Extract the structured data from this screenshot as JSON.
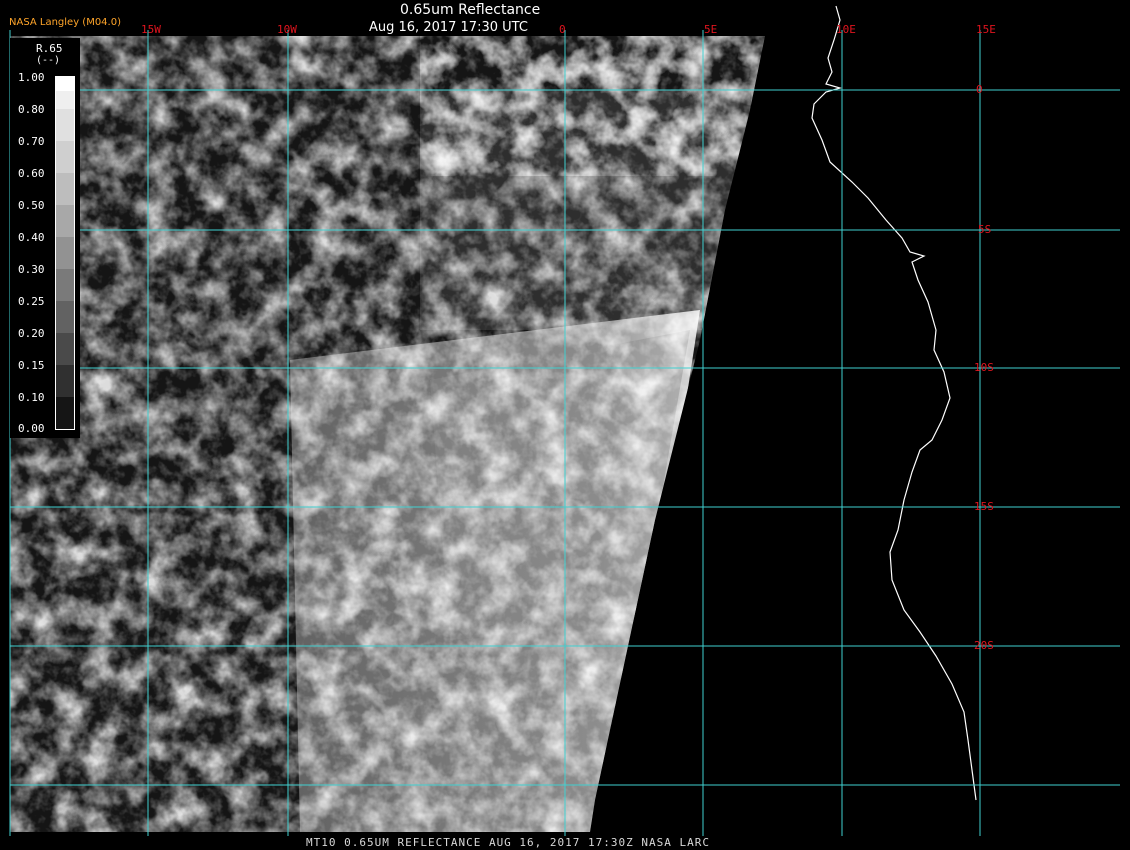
{
  "header": {
    "title": "0.65um Reflectance",
    "subtitle": "Aug 16, 2017 17:30 UTC",
    "provider": "NASA Langley (M04.0)"
  },
  "legend": {
    "title": "R.65",
    "units": "(--)",
    "ticks": [
      "1.00",
      "0.80",
      "0.70",
      "0.60",
      "0.50",
      "0.40",
      "0.30",
      "0.25",
      "0.20",
      "0.15",
      "0.10",
      "0.00"
    ]
  },
  "grid": {
    "longitudes": [
      "15W",
      "10W",
      "0",
      "5E",
      "10E",
      "15E"
    ],
    "latitudes": [
      "0",
      "5S",
      "10S",
      "15S",
      "20S"
    ],
    "line_color": "#40d0d0",
    "label_color": "#e0141e"
  },
  "footer": {
    "text": "MT10  0.65UM REFLECTANCE   AUG 16, 2017 17:30Z   NASA LARC"
  },
  "colors": {
    "background": "#000000",
    "coastline": "#ffffff",
    "title": "#ffffff",
    "provider": "#ffa52a"
  }
}
